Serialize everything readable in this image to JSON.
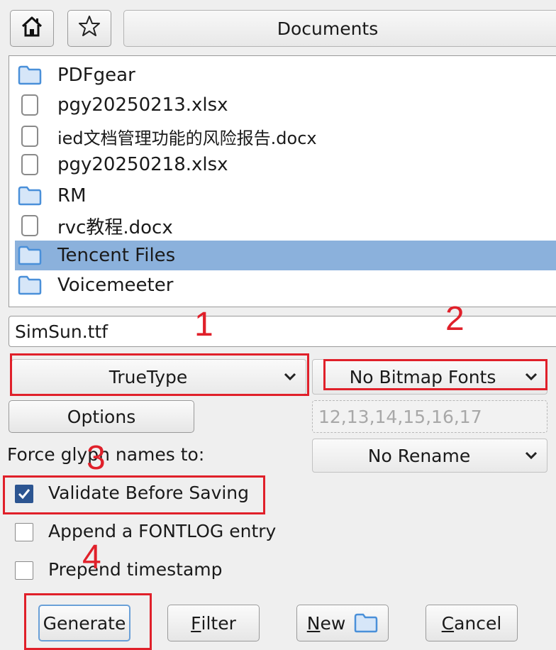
{
  "toolbar": {
    "home_icon": "home-icon",
    "bookmark_icon": "star-icon",
    "path": "Documents"
  },
  "files": [
    {
      "name": "PDFgear",
      "type": "folder"
    },
    {
      "name": "pgy20250213.xlsx",
      "type": "file"
    },
    {
      "name": "ied文档管理功能的风险报告.docx",
      "type": "file"
    },
    {
      "name": "pgy20250218.xlsx",
      "type": "file"
    },
    {
      "name": "RM",
      "type": "folder"
    },
    {
      "name": "rvc教程.docx",
      "type": "file"
    },
    {
      "name": "Tencent Files",
      "type": "folder",
      "selected": true
    },
    {
      "name": "Voicemeeter",
      "type": "folder"
    }
  ],
  "filename": {
    "value": "SimSun.ttf"
  },
  "format": {
    "selected": "TrueType"
  },
  "bitmap": {
    "selected": "No Bitmap Fonts"
  },
  "options_button": "Options",
  "sizes": {
    "placeholder": "12,13,14,15,16,17"
  },
  "glyph_names": {
    "label": "Force glyph names to:",
    "selected": "No Rename"
  },
  "checks": {
    "validate": {
      "label": "Validate Before Saving",
      "checked": true
    },
    "fontlog": {
      "label": "Append a FONTLOG entry",
      "checked": false
    },
    "timestamp": {
      "label": "Prepend timestamp",
      "checked": false
    }
  },
  "buttons": {
    "generate": "Generate",
    "filter": {
      "mnemonic": "F",
      "rest": "ilter"
    },
    "new": {
      "mnemonic": "N",
      "rest": "ew"
    },
    "cancel": {
      "mnemonic": "C",
      "rest": "ancel"
    }
  },
  "annotations": [
    "1",
    "2",
    "3",
    "4"
  ],
  "colors": {
    "selection": "#8bb1dc",
    "annotation": "#e0202a",
    "folder": "#4a90d9",
    "checked": "#2c5591"
  }
}
